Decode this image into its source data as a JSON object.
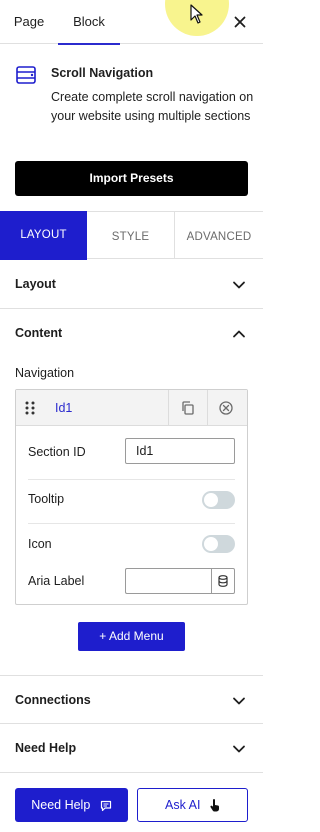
{
  "tabs": {
    "page": "Page",
    "block": "Block"
  },
  "block": {
    "title": "Scroll Navigation",
    "description": "Create complete scroll navigation on your website using multiple sections",
    "icon": "scroll-navigation-icon"
  },
  "import_presets_label": "Import Presets",
  "style_tabs": {
    "layout": "LAYOUT",
    "style": "STYLE",
    "advanced": "ADVANCED",
    "active": "LAYOUT"
  },
  "panels": {
    "layout": "Layout",
    "content": "Content",
    "connections": "Connections",
    "need_help": "Need Help"
  },
  "navigation": {
    "label": "Navigation",
    "item": {
      "title": "Id1",
      "section_id_label": "Section ID",
      "section_id_value": "Id1",
      "tooltip_label": "Tooltip",
      "tooltip_on": false,
      "icon_label": "Icon",
      "icon_on": false,
      "aria_label_label": "Aria Label",
      "aria_label_value": ""
    }
  },
  "add_menu_label": "+ Add Menu",
  "footer": {
    "need_help_label": "Need Help",
    "ask_ai_label": "Ask AI"
  },
  "colors": {
    "accent": "#1e1ecd",
    "toggle_off": "#cfd8dc",
    "highlight": "#f7f27a"
  }
}
